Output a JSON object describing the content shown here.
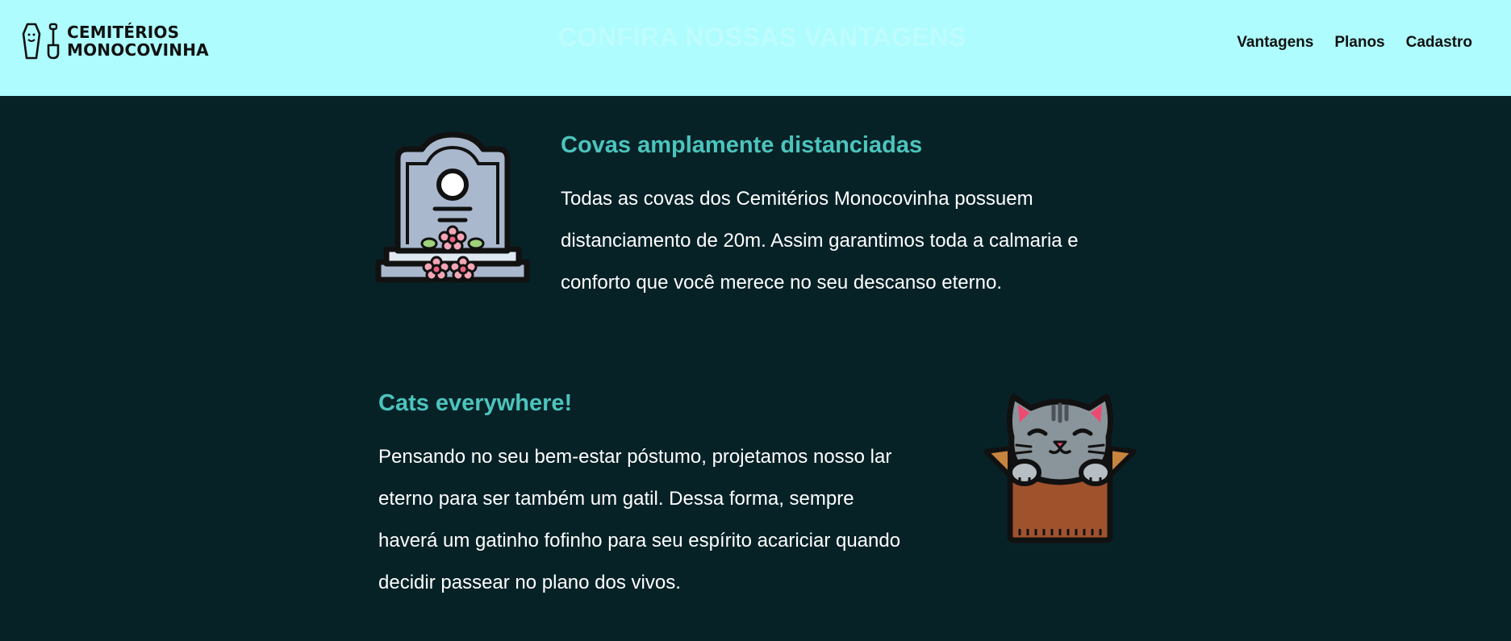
{
  "header": {
    "logo": {
      "line1": "CEMITÉRIOS",
      "line2": "MONOCOVINHA",
      "icons": [
        "coffin-icon",
        "shovel-icon"
      ]
    },
    "ghost_title": "CONFIRA NOSSAS VANTAGENS",
    "nav": [
      "Vantagens",
      "Planos",
      "Cadastro"
    ]
  },
  "features": [
    {
      "title": "Covas amplamente distanciadas",
      "lines": [
        "Todas as covas dos Cemitérios Monocovinha possuem",
        "distanciamento de 20m. Assim garantimos toda a calmaria e",
        "conforto que você merece no seu descanso eterno."
      ],
      "icon": "tombstone-icon"
    },
    {
      "title": "Cats everywhere!",
      "lines": [
        "Pensando no seu bem-estar póstumo, projetamos nosso lar",
        "eterno para ser também um gatil. Dessa forma, sempre",
        "haverá um gatinho fofinho para seu espírito acariciar quando",
        "decidir passear no plano dos vivos."
      ],
      "icon": "cat-in-box-icon"
    }
  ],
  "colors": {
    "header_bg": "#aefcfd",
    "page_bg": "#072227",
    "accent": "#4cc4bd",
    "text": "#ffffff"
  }
}
